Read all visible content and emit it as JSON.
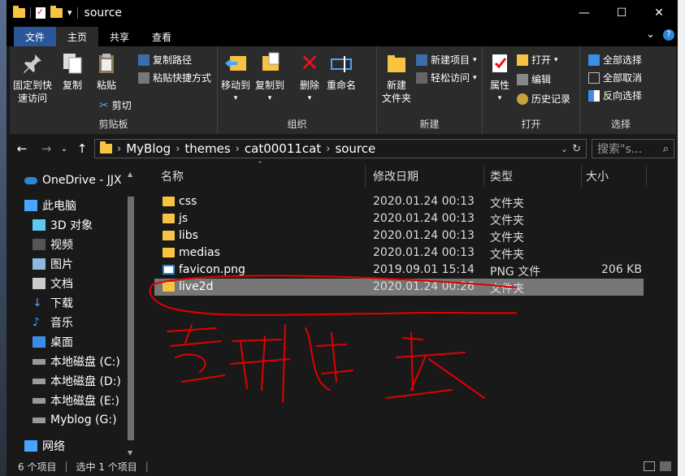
{
  "window": {
    "title": "source"
  },
  "titlebar": {
    "minimize": "—",
    "maximize": "☐",
    "close": "✕",
    "dropdown": "▾"
  },
  "tabs": {
    "file": "文件",
    "home": "主页",
    "share": "共享",
    "view": "查看",
    "collapse": "⌄"
  },
  "ribbon": {
    "pin_quick_access": "固定到快\n速访问",
    "copy": "复制",
    "paste": "粘贴",
    "copy_path": "复制路径",
    "paste_shortcut": "粘贴快捷方式",
    "cut": "剪切",
    "clipboard_group": "剪贴板",
    "move_to": "移动到",
    "copy_to": "复制到",
    "delete": "删除",
    "rename": "重命名",
    "organize_group": "组织",
    "new_folder": "新建\n文件夹",
    "new_item": "新建项目",
    "easy_access": "轻松访问",
    "new_group": "新建",
    "properties": "属性",
    "open": "打开",
    "edit": "编辑",
    "history": "历史记录",
    "open_group": "打开",
    "select_all": "全部选择",
    "select_none": "全部取消",
    "invert_selection": "反向选择",
    "select_group": "选择"
  },
  "address": {
    "crumbs": [
      "MyBlog",
      "themes",
      "cat00011cat",
      "source"
    ],
    "search_placeholder": "搜索\"s..."
  },
  "nav": {
    "items": [
      "OneDrive - JJX",
      "此电脑",
      "3D 对象",
      "视频",
      "图片",
      "文档",
      "下载",
      "音乐",
      "桌面",
      "本地磁盘 (C:)",
      "本地磁盘 (D:)",
      "本地磁盘 (E:)",
      "Myblog (G:)",
      "网络"
    ]
  },
  "columns": {
    "name": "名称",
    "date": "修改日期",
    "type": "类型",
    "size": "大小"
  },
  "files": [
    {
      "name": "css",
      "date": "2020.01.24 00:13",
      "type": "文件夹",
      "size": ""
    },
    {
      "name": "js",
      "date": "2020.01.24 00:13",
      "type": "文件夹",
      "size": ""
    },
    {
      "name": "libs",
      "date": "2020.01.24 00:13",
      "type": "文件夹",
      "size": ""
    },
    {
      "name": "medias",
      "date": "2020.01.24 00:13",
      "type": "文件夹",
      "size": ""
    },
    {
      "name": "favicon.png",
      "date": "2019.09.01 15:14",
      "type": "PNG 文件",
      "size": "206 KB"
    },
    {
      "name": "live2d",
      "date": "2020.01.24 00:26",
      "type": "文件夹",
      "size": ""
    }
  ],
  "status": {
    "count": "6 个项目",
    "selected": "选中 1 个项目"
  },
  "colors": {
    "accent": "#2b579a",
    "annotation": "#e00000",
    "folder": "#f6c343"
  }
}
